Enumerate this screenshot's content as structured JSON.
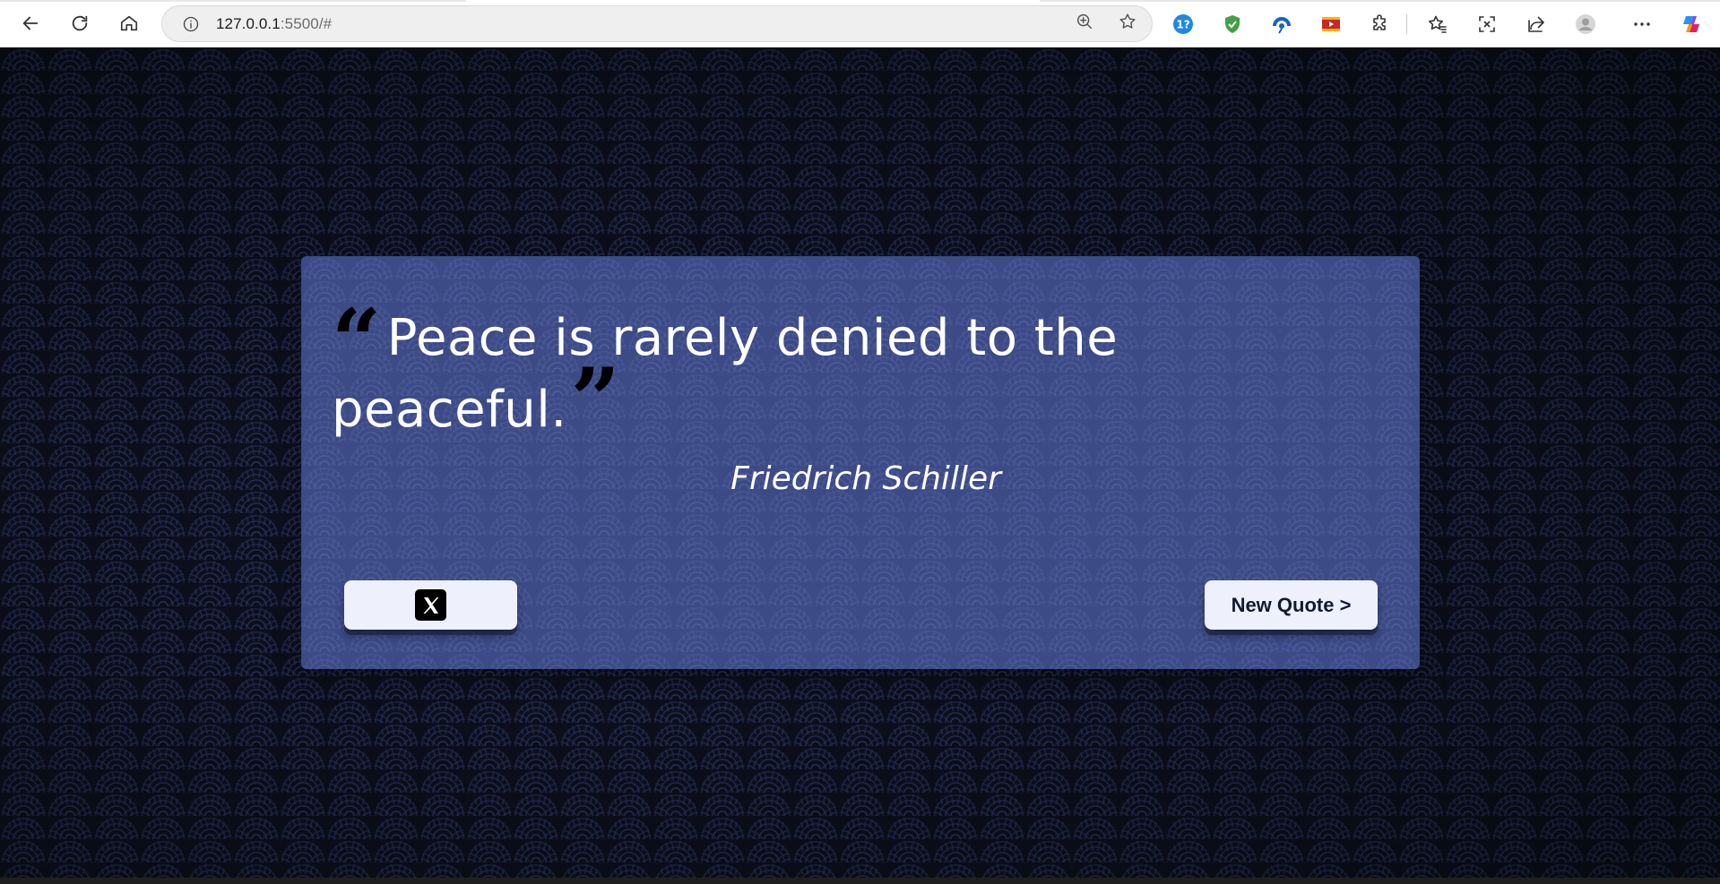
{
  "browser": {
    "url_host": "127.0.0.1",
    "url_rest": ":5500/#",
    "icons": {
      "back": "back-arrow-icon",
      "reload": "reload-icon",
      "home": "home-icon",
      "info": "site-info-icon",
      "zoom": "zoom-icon",
      "favorite": "star-icon",
      "extensions": [
        "ext-1-icon",
        "ext-shield-icon",
        "ext-3-icon",
        "ext-video-icon",
        "puzzle-icon",
        "favorites-icon",
        "screenshot-icon",
        "share-icon",
        "profile-icon",
        "more-icon",
        "copilot-icon"
      ]
    }
  },
  "quote": {
    "text": "Peace is rarely denied to the peaceful.",
    "author": "Friedrich Schiller"
  },
  "buttons": {
    "tweet_icon": "x-logo-icon",
    "new_quote": "New Quote >"
  },
  "colors": {
    "background": "#0c0f1c",
    "card": "#3c4a86",
    "button": "#eef1fb",
    "text": "#ffffff"
  }
}
